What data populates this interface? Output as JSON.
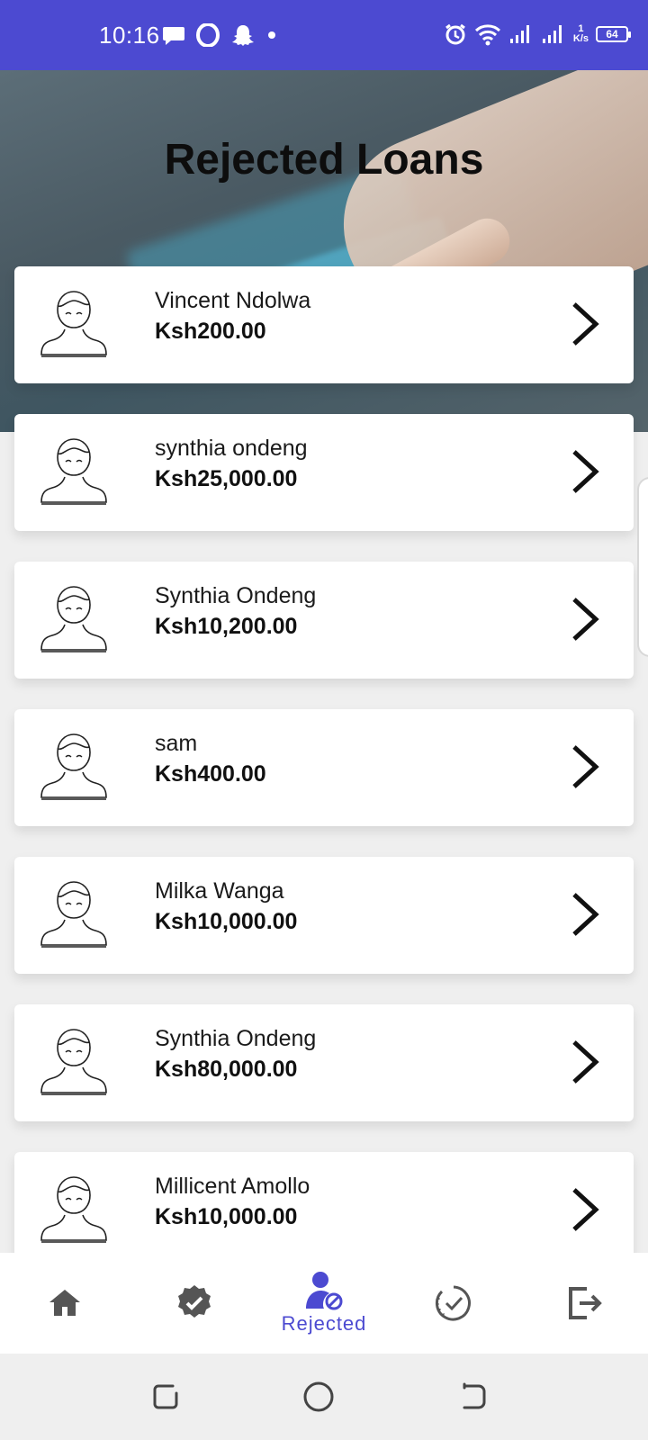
{
  "status_bar": {
    "time": "10:16",
    "net_speed_value": "1",
    "net_speed_unit": "K/s",
    "battery": "64",
    "color": "#4c4ad1"
  },
  "header": {
    "title": "Rejected Loans"
  },
  "loans": [
    {
      "name": "Vincent Ndolwa",
      "amount": "Ksh200.00"
    },
    {
      "name": "synthia ondeng",
      "amount": "Ksh25,000.00"
    },
    {
      "name": "Synthia Ondeng",
      "amount": "Ksh10,200.00"
    },
    {
      "name": "sam",
      "amount": "Ksh400.00"
    },
    {
      "name": "Milka Wanga",
      "amount": "Ksh10,000.00"
    },
    {
      "name": "Synthia Ondeng",
      "amount": "Ksh80,000.00"
    },
    {
      "name": "Millicent Amollo",
      "amount": "Ksh10,000.00"
    }
  ],
  "bottom_nav": {
    "items": [
      {
        "icon": "home-icon",
        "label": ""
      },
      {
        "icon": "verified-badge-icon",
        "label": ""
      },
      {
        "icon": "user-blocked-icon",
        "label": "Rejected",
        "active": true
      },
      {
        "icon": "progress-check-icon",
        "label": ""
      },
      {
        "icon": "logout-icon",
        "label": ""
      }
    ],
    "active_color": "#4c4ad1",
    "inactive_color": "#555555"
  },
  "system_nav": {
    "buttons": [
      "recents-button",
      "home-button",
      "back-button"
    ]
  }
}
